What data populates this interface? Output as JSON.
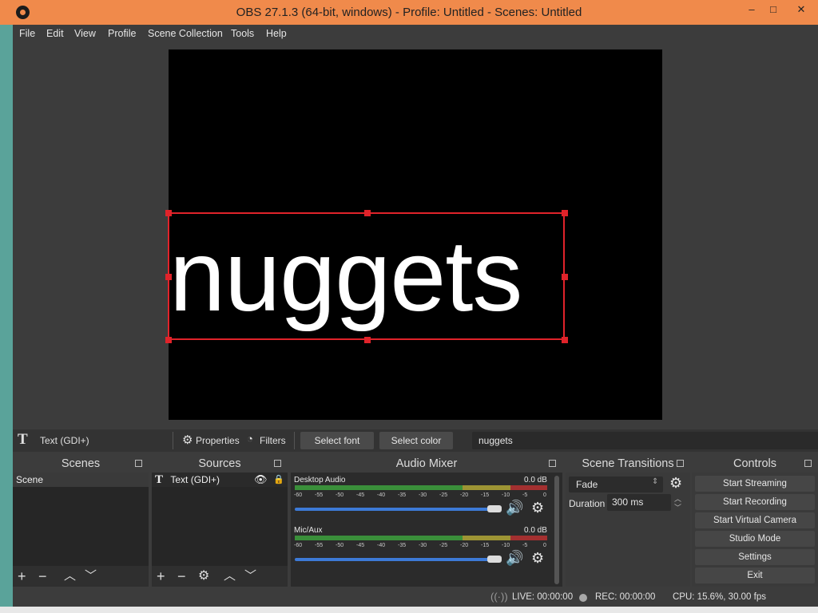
{
  "window": {
    "title": "OBS 27.1.3 (64-bit, windows) - Profile: Untitled - Scenes: Untitled",
    "controls": [
      "–",
      "□",
      "✕"
    ]
  },
  "menu": [
    "File",
    "Edit",
    "View",
    "Profile",
    "Scene Collection",
    "Tools",
    "Help"
  ],
  "preview": {
    "text": "nuggets",
    "selection_color": "#e0232a"
  },
  "properties_bar": {
    "source_name": "Text (GDI+)",
    "properties_label": "Properties",
    "filters_label": "Filters",
    "select_font_label": "Select font",
    "select_color_label": "Select color",
    "text_value": "nuggets"
  },
  "scenes": {
    "title": "Scenes",
    "items": [
      "Scene"
    ]
  },
  "sources": {
    "title": "Sources",
    "items": [
      "Text (GDI+)"
    ]
  },
  "mixer": {
    "title": "Audio Mixer",
    "channels": [
      {
        "name": "Desktop Audio",
        "db": "0.0 dB"
      },
      {
        "name": "Mic/Aux",
        "db": "0.0 dB"
      }
    ],
    "ticks": [
      "-60",
      "-55",
      "-50",
      "-45",
      "-40",
      "-35",
      "-30",
      "-25",
      "-20",
      "-15",
      "-10",
      "-5",
      "0"
    ]
  },
  "transitions": {
    "title": "Scene Transitions",
    "selected": "Fade",
    "duration_label": "Duration",
    "duration_value": "300 ms"
  },
  "controls": {
    "title": "Controls",
    "buttons": [
      "Start Streaming",
      "Start Recording",
      "Start Virtual Camera",
      "Studio Mode",
      "Settings",
      "Exit"
    ]
  },
  "status": {
    "live": "LIVE: 00:00:00",
    "rec": "REC: 00:00:00",
    "cpu": "CPU: 15.6%, 30.00 fps"
  },
  "colors": {
    "titlebar": "#f08a4b",
    "accent_blue": "#3d7ad6"
  }
}
